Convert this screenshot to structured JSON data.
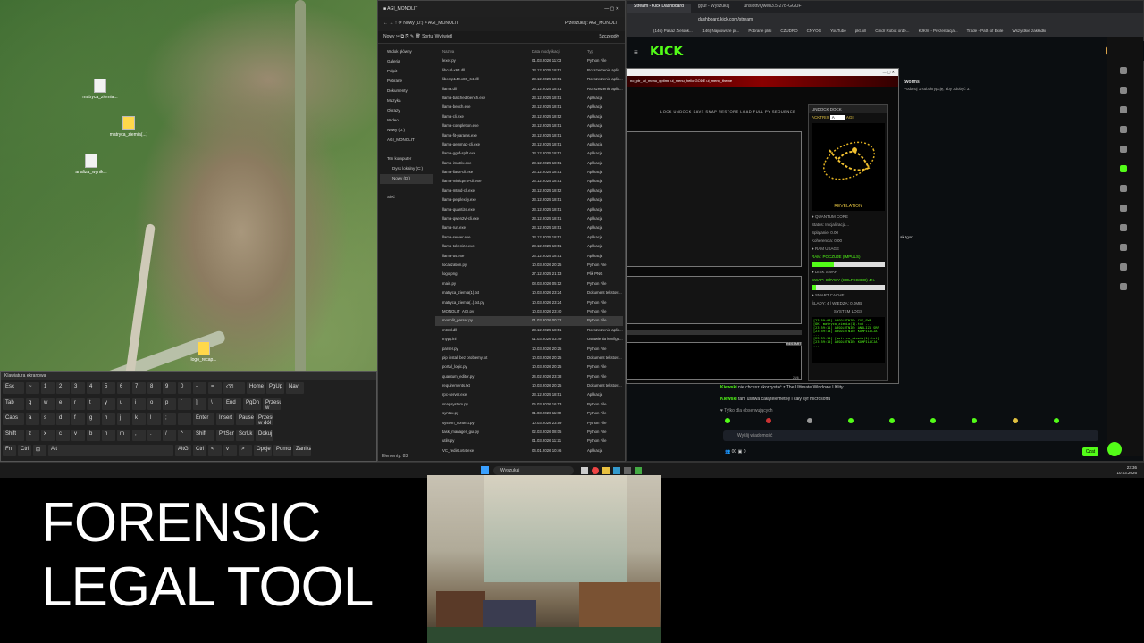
{
  "desktop": {
    "icons": [
      {
        "label": "matryca_ziemia..."
      },
      {
        "label": "matryca_ziemia(...)"
      },
      {
        "label": "analiza_wynik..."
      },
      {
        "label": "logo_recap..."
      }
    ]
  },
  "osk": {
    "title": "Klawiatura ekranowa",
    "row1": [
      "Esc",
      "~",
      "1",
      "2",
      "3",
      "4",
      "5",
      "6",
      "7",
      "8",
      "9",
      "0",
      "-",
      "=",
      "⌫",
      "Home",
      "PgUp",
      "Nav"
    ],
    "row2": [
      "Tab",
      "q",
      "w",
      "e",
      "r",
      "t",
      "y",
      "u",
      "i",
      "o",
      "p",
      "[",
      "]",
      "\\",
      "End",
      "PgDn",
      "Przesuń w górę"
    ],
    "row3": [
      "Caps",
      "a",
      "s",
      "d",
      "f",
      "g",
      "h",
      "j",
      "k",
      "l",
      ";",
      "'",
      "Enter",
      "Insert",
      "Pause",
      "Przesuń w dół"
    ],
    "row4": [
      "Shift",
      "z",
      "x",
      "c",
      "v",
      "b",
      "n",
      "m",
      ",",
      ".",
      "/",
      "^",
      "Shift",
      "PrtScn",
      "ScrLk",
      "Dokuj"
    ],
    "row5": [
      "Fn",
      "Ctrl",
      "⊞",
      "Alt",
      "AltGr",
      "Ctrl",
      "<",
      "v",
      ">",
      "Opcje",
      "Pomoc",
      "Zanikanie"
    ]
  },
  "explorer": {
    "tab_title": "AGI_MONOLIT",
    "address": "Nowy (D:)  >  AGI_MONOLIT",
    "search_placeholder": "Przeszukaj: AGI_MONOLIT",
    "new_label": "Nowy",
    "sort_label": "Sortuj",
    "view_label": "Wyświetl",
    "details_label": "Szczegóły",
    "nav": [
      "Widok główny",
      "Galeria",
      "Pulpit",
      "Pobrane",
      "Dokumenty",
      "Muzyka",
      "Obrazy",
      "Wideo",
      "Nowy (D:)",
      "AGI_MONOLIT",
      "Ten komputer",
      "Dysk lokalny (C:)",
      "Nowy (D:)",
      "Sieć"
    ],
    "cols": {
      "name": "Nazwa",
      "date": "Data modyfikacji",
      "type": "Typ"
    },
    "files": [
      {
        "n": "lexer.py",
        "d": "01.03.2026 11:03",
        "t": "Python File"
      },
      {
        "n": "libcurl-x64.dll",
        "d": "23.12.2025 18:51",
        "t": "Rozszerzenie aplik..."
      },
      {
        "n": "libomp140.x86_64.dll",
        "d": "23.12.2025 18:51",
        "t": "Rozszerzenie aplik..."
      },
      {
        "n": "llama.dll",
        "d": "23.12.2025 18:51",
        "t": "Rozszerzenie aplik..."
      },
      {
        "n": "llama-batched-bench.exe",
        "d": "23.12.2025 18:51",
        "t": "Aplikacja"
      },
      {
        "n": "llama-bench.exe",
        "d": "23.12.2025 18:51",
        "t": "Aplikacja"
      },
      {
        "n": "llama-cli.exe",
        "d": "23.12.2025 18:52",
        "t": "Aplikacja"
      },
      {
        "n": "llama-completion.exe",
        "d": "23.12.2025 18:51",
        "t": "Aplikacja"
      },
      {
        "n": "llama-fit-params.exe",
        "d": "23.12.2025 18:51",
        "t": "Aplikacja"
      },
      {
        "n": "llama-gemma3-cli.exe",
        "d": "23.12.2025 18:51",
        "t": "Aplikacja"
      },
      {
        "n": "llama-gguf-split.exe",
        "d": "23.12.2025 18:51",
        "t": "Aplikacja"
      },
      {
        "n": "llama-imatrix.exe",
        "d": "23.12.2025 18:51",
        "t": "Aplikacja"
      },
      {
        "n": "llama-llava-cli.exe",
        "d": "23.12.2025 18:51",
        "t": "Aplikacja"
      },
      {
        "n": "llama-minicpmv-cli.exe",
        "d": "23.12.2025 18:51",
        "t": "Aplikacja"
      },
      {
        "n": "llama-mtmd-cli.exe",
        "d": "23.12.2025 18:52",
        "t": "Aplikacja"
      },
      {
        "n": "llama-perplexity.exe",
        "d": "23.12.2025 18:51",
        "t": "Aplikacja"
      },
      {
        "n": "llama-quantize.exe",
        "d": "23.12.2025 18:51",
        "t": "Aplikacja"
      },
      {
        "n": "llama-qwen2vl-cli.exe",
        "d": "23.12.2025 18:51",
        "t": "Aplikacja"
      },
      {
        "n": "llama-run.exe",
        "d": "23.12.2025 18:51",
        "t": "Aplikacja"
      },
      {
        "n": "llama-server.exe",
        "d": "23.12.2025 18:51",
        "t": "Aplikacja"
      },
      {
        "n": "llama-tokenize.exe",
        "d": "23.12.2025 18:51",
        "t": "Aplikacja"
      },
      {
        "n": "llama-tts.exe",
        "d": "23.12.2025 18:51",
        "t": "Aplikacja"
      },
      {
        "n": "localization.py",
        "d": "10.03.2026 20:25",
        "t": "Python File"
      },
      {
        "n": "logo.png",
        "d": "27.12.2025 21:13",
        "t": "Plik PNG"
      },
      {
        "n": "main.py",
        "d": "08.03.2026 05:12",
        "t": "Python File"
      },
      {
        "n": "matryca_ziemia(1).txt",
        "d": "10.03.2026 23:24",
        "t": "Dokument tekstow..."
      },
      {
        "n": "matryca_ziemia(..).txt.py",
        "d": "10.03.2026 23:24",
        "t": "Python File"
      },
      {
        "n": "MONOLIT_AGI.py",
        "d": "10.03.2026 23:40",
        "t": "Python File"
      },
      {
        "n": "monolit_parser.py",
        "d": "01.03.2026 00:32",
        "t": "Python File"
      },
      {
        "n": "mtmd.dll",
        "d": "23.12.2025 18:51",
        "t": "Rozszerzenie aplik..."
      },
      {
        "n": "mypy.ini",
        "d": "01.03.2026 03:49",
        "t": "Ustawienia konfigu..."
      },
      {
        "n": "parser.py",
        "d": "10.03.2026 20:25",
        "t": "Python File"
      },
      {
        "n": "pip install bez problemy.txt",
        "d": "10.03.2026 20:25",
        "t": "Dokument tekstow..."
      },
      {
        "n": "portal_logic.py",
        "d": "10.03.2026 20:25",
        "t": "Python File"
      },
      {
        "n": "quantum_editor.py",
        "d": "24.02.2026 23:38",
        "t": "Python File"
      },
      {
        "n": "requirements.txt",
        "d": "10.03.2026 20:25",
        "t": "Dokument tekstow..."
      },
      {
        "n": "rpc-server.exe",
        "d": "23.12.2025 18:51",
        "t": "Aplikacja"
      },
      {
        "n": "snapsystem.py",
        "d": "05.03.2026 16:13",
        "t": "Python File"
      },
      {
        "n": "syntax.py",
        "d": "01.03.2026 11:00",
        "t": "Python File"
      },
      {
        "n": "system_context.py",
        "d": "10.03.2026 23:59",
        "t": "Python File"
      },
      {
        "n": "task_manager_gui.py",
        "d": "02.03.2026 08:05",
        "t": "Python File"
      },
      {
        "n": "utils.py",
        "d": "01.03.2026 11:21",
        "t": "Python File"
      },
      {
        "n": "VC_redist.x64.exe",
        "d": "04.01.2026 10:46",
        "t": "Aplikacja"
      }
    ],
    "status": "Elementy: 83"
  },
  "browser": {
    "tabs": [
      "Stream - Kick Dashboard",
      "gguf - Wyszukaj",
      "unsloth/Qwen3.5-27B-GGUF"
    ],
    "url": "dashboard.kick.com/stream",
    "bookmarks": [
      "(146) Pasaż Zielonk...",
      "(146) Najnowsze pr...",
      "Pobrane pliki",
      "CZUDRO",
      "CNYOG",
      "YouTube",
      "pkt.kill",
      "Cmdr Robot orde...",
      "KJKW - Prezentacja...",
      "Trade - Path of Exile",
      "Wszystkie zakładki"
    ],
    "logo": "KICK",
    "chat_header": "Czat",
    "chat_user": "tworms",
    "chat_sub": "Podaruj 1 subskrypcję, aby zdobyć 3.",
    "chat_snippet": "ak Igor",
    "messages": [
      {
        "user": "Kiewski",
        "text": "nie chcesz skorzystać z The Ultimate Windows Utility"
      },
      {
        "user": "Kiewski",
        "text": "tam usuwa całą telemetrię i cały syf microsoftu"
      }
    ],
    "followers_note": "Tylko dla obserwujących",
    "chat_placeholder": "Wyślij wiadomość",
    "viewers": "00",
    "points": "0",
    "send_label": "Czat"
  },
  "app": {
    "banner": "no_ptr_   ui_menu_uptime   ui_menu_hello   GODE   ui_menu_theme",
    "topbuttons": "LOCK  UNDOCK  SAVE  SNAP  RESTORE  LOAD FULL PY SEQUENCE",
    "side_header": [
      "UNDOCK",
      "DOCK"
    ],
    "acktrix": "ACKTRIX",
    "field_val": "A",
    "field_tag": "AGI",
    "revelation": "REVELATION",
    "quantum_core": "QUANTUM CORE",
    "status": "Status: Inicjalizacja...",
    "splatanie": "Splątanie: 0.00",
    "koherencja": "Koherencja: 0.00",
    "ram_usage": "RAM USAGE",
    "ram_label": "RAM: POCZUJE (IMPULS)",
    "ram_fill": 0.3,
    "disk_swap": "DISK SWAP",
    "swap_label": "SWAP: OŻYWY (SOLFEGGIO) 4%",
    "swap_fill": 0.06,
    "smart_cache": "SMART CACHE",
    "cache_label": "ŚLADY: 4 | WIEDZA: 0.0MB",
    "system_logs": "SYSTEM LOGS",
    "logs": [
      "[23:59:08] ABSOLUTNIE: CVE_SWP ...",
      "[OK] matryca_ziemia(1).txt ...",
      "[23:59:11] ABSOLUTNIE: ANALIZA SRF",
      "[23:59:14] ABSOLUTNIE: KOMPILACJA ...",
      "[23:59:14] [matryca_ziemia(1).txt]",
      "[23:59:15] ABSOLUTNIE: KOMPILACJA ..."
    ],
    "restart": "RESTART",
    "bottom_count": "26/6"
  },
  "taskbar": {
    "search": "Wyszukaj",
    "time": "23:36",
    "date": "10.03.2026"
  },
  "overlay": {
    "line1": "FORENSIC",
    "line2": "LEGAL TOOL"
  },
  "colors": {
    "kick_green": "#53fc18",
    "banner_red": "#8a0000",
    "taskbar": "#1b1b1b"
  }
}
